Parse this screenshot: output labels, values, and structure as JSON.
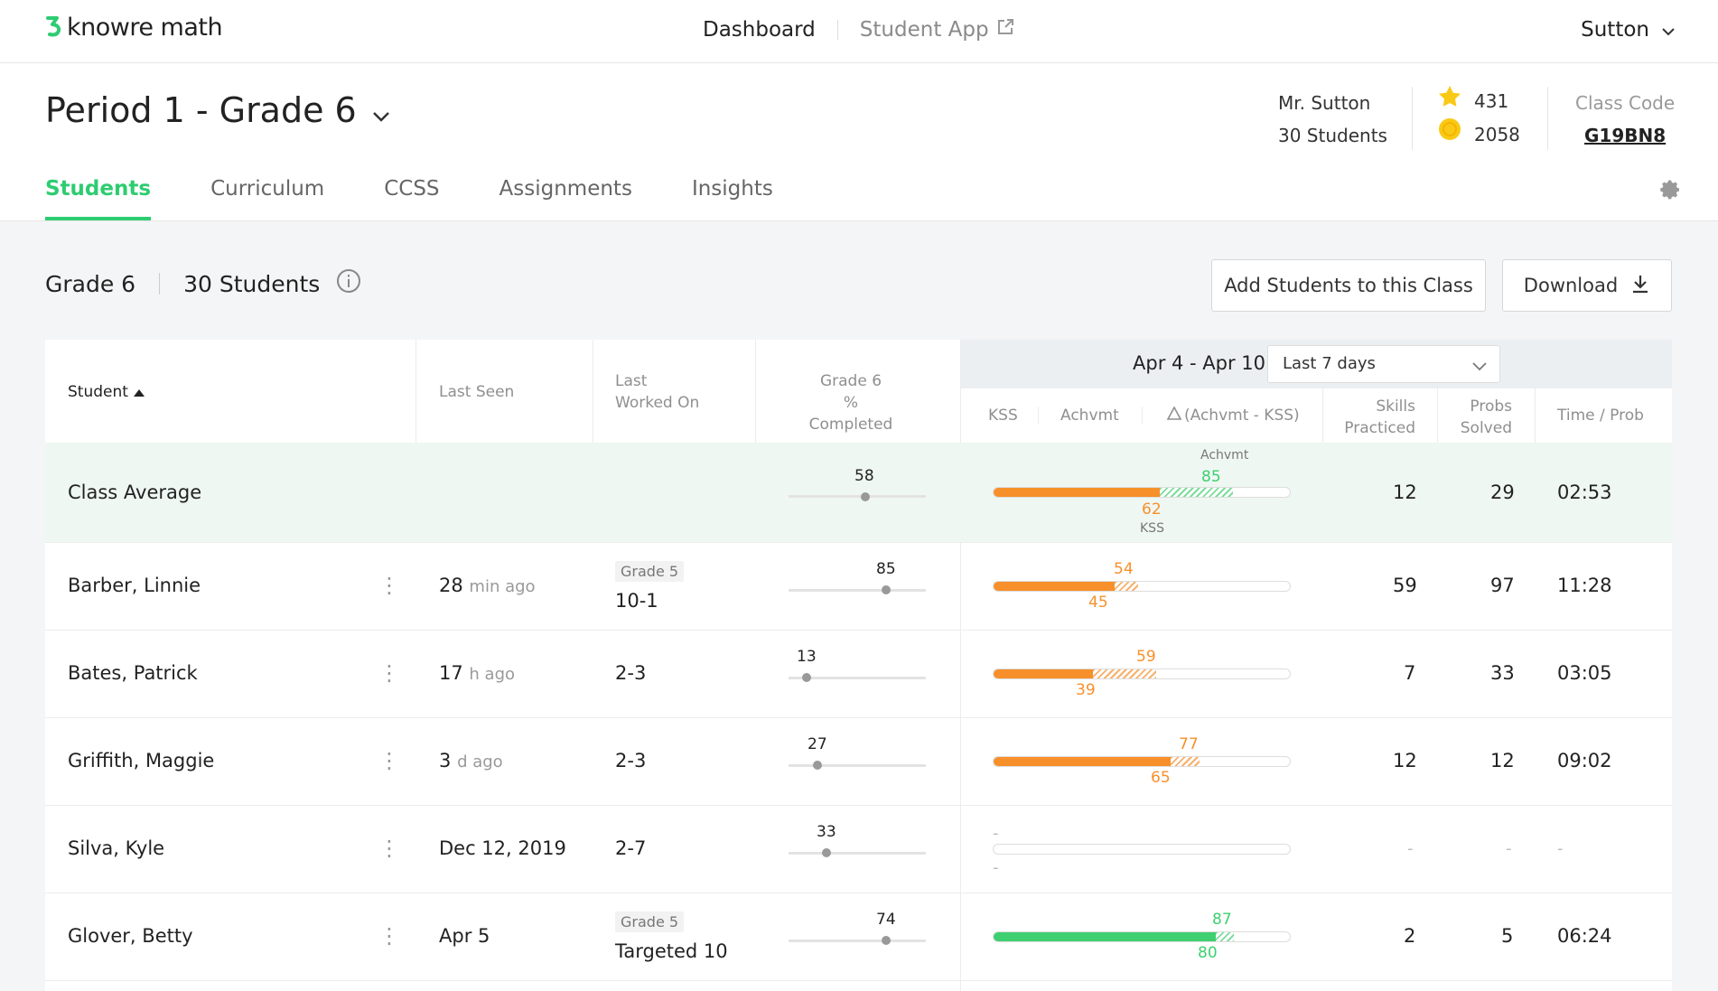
{
  "app": {
    "logo_text": "knowre math",
    "nav": {
      "dashboard": "Dashboard",
      "student_app": "Student App"
    },
    "user": "Sutton"
  },
  "class": {
    "title": "Period 1 - Grade 6",
    "teacher": "Mr. Sutton",
    "students_count": "30 Students",
    "stars": "431",
    "coins": "2058",
    "class_code_label": "Class Code",
    "class_code": "G19BN8"
  },
  "tabs": [
    "Students",
    "Curriculum",
    "CCSS",
    "Assignments",
    "Insights"
  ],
  "section": {
    "grade": "Grade 6",
    "students": "30 Students",
    "add_button": "Add Students to this Class",
    "download_button": "Download"
  },
  "table": {
    "headers": {
      "student": "Student",
      "last_seen": "Last Seen",
      "last_worked_1": "Last",
      "last_worked_2": "Worked On",
      "completed_1": "Grade 6",
      "completed_2": "% Completed",
      "kss": "KSS",
      "achvmt": "Achvmt",
      "delta": "(Achvmt - KSS)",
      "skills_1": "Skills",
      "skills_2": "Practiced",
      "probs_1": "Probs",
      "probs_2": "Solved",
      "time": "Time / Prob"
    },
    "date_range": "Apr 4 - Apr 10",
    "range_select": "Last 7 days",
    "average": {
      "name": "Class Average",
      "completed": "58",
      "achvmt_label": "Achvmt",
      "kss_label": "KSS",
      "achvmt": "85",
      "kss": "62",
      "skills": "12",
      "probs": "29",
      "time": "02:53"
    },
    "rows": [
      {
        "name": "Barber, Linnie",
        "seen_num": "28",
        "seen_unit": "min ago",
        "grade_tag": "Grade 5",
        "worked": "10-1",
        "completed": "85",
        "achvmt": "54",
        "kss": "45",
        "skills": "59",
        "probs": "97",
        "time": "11:28"
      },
      {
        "name": "Bates, Patrick",
        "seen_num": "17",
        "seen_unit": "h ago",
        "grade_tag": "",
        "worked": "2-3",
        "completed": "13",
        "achvmt": "59",
        "kss": "39",
        "skills": "7",
        "probs": "33",
        "time": "03:05"
      },
      {
        "name": "Griffith, Maggie",
        "seen_num": "3",
        "seen_unit": "d ago",
        "grade_tag": "",
        "worked": "2-3",
        "completed": "27",
        "achvmt": "77",
        "kss": "65",
        "skills": "12",
        "probs": "12",
        "time": "09:02"
      },
      {
        "name": "Silva, Kyle",
        "seen_num": "Dec 12, 2019",
        "seen_unit": "",
        "grade_tag": "",
        "worked": "2-7",
        "completed": "33",
        "achvmt": "-",
        "kss": "-",
        "skills": "-",
        "probs": "-",
        "time": "-"
      },
      {
        "name": "Glover, Betty",
        "seen_num": "Apr 5",
        "seen_unit": "",
        "grade_tag": "Grade 5",
        "worked": "Targeted 10",
        "completed": "74",
        "achvmt": "87",
        "kss": "80",
        "skills": "2",
        "probs": "5",
        "time": "06:24"
      }
    ]
  },
  "colors": {
    "accent": "#2ecc71",
    "kss_orange": "#f7902a",
    "green_bar": "#3ecf70"
  }
}
